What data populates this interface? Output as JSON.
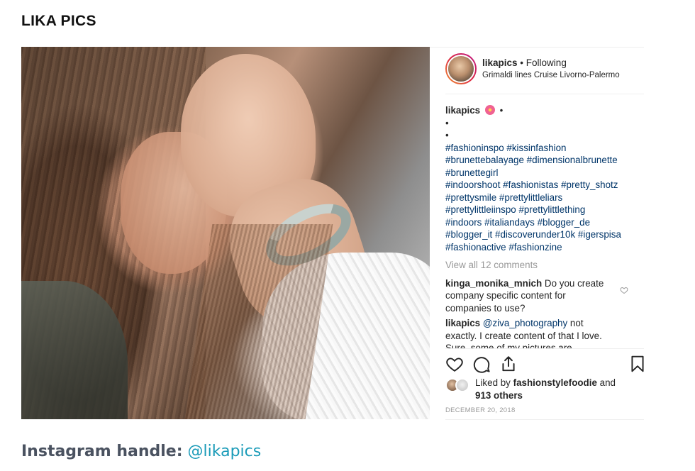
{
  "page": {
    "title": "LIKA PICS"
  },
  "post": {
    "username": "likapics",
    "separator": "•",
    "follow_status": "Following",
    "location": "Grimaldi lines Cruise Livorno-Palermo",
    "caption": {
      "username": "likapics",
      "trailing": "•",
      "dot_lines": [
        "•",
        "•"
      ],
      "hashtag_lines": [
        [
          "#fashioninspo",
          "#kissinfashion"
        ],
        [
          "#brunettebalayage",
          "#dimensionalbrunette"
        ],
        [
          "#brunettegirl"
        ],
        [
          "#indoorshoot",
          "#fashionistas",
          "#pretty_shotz"
        ],
        [
          "#prettysmile",
          "#prettylittleliars"
        ],
        [
          "#prettylittleiinspo",
          "#prettylittlething"
        ],
        [
          "#indoors",
          "#italiandays",
          "#blogger_de"
        ],
        [
          "#blogger_it",
          "#discoverunder10k",
          "#igerspisa"
        ],
        [
          "#fashionactive",
          "#fashionzine"
        ]
      ]
    },
    "view_all": "View all 12 comments",
    "comments": [
      {
        "username": "kinga_monika_mnich",
        "text": "Do you create company specific content for companies to use?"
      },
      {
        "username": "likapics",
        "mention": "@ziva_photography",
        "text": "not exactly. I create content of that I love. Sure, some of my pictures are"
      }
    ],
    "likes": {
      "prefix": "Liked by",
      "liker": "fashionstylefoodie",
      "and": "and",
      "others": "913 others"
    },
    "date": "DECEMBER 20, 2018",
    "icons": {
      "like": "heart-icon",
      "comment": "comment-icon",
      "share": "share-icon",
      "save": "bookmark-icon",
      "comment_like": "heart-icon"
    }
  },
  "footer": {
    "label": "Instagram handle:",
    "handle": "@likapics"
  },
  "colors": {
    "link": "#003569",
    "muted": "#999999",
    "footer_label": "#4a5260",
    "footer_link": "#1a9bb8",
    "avatar_ring": "#dc2743"
  }
}
